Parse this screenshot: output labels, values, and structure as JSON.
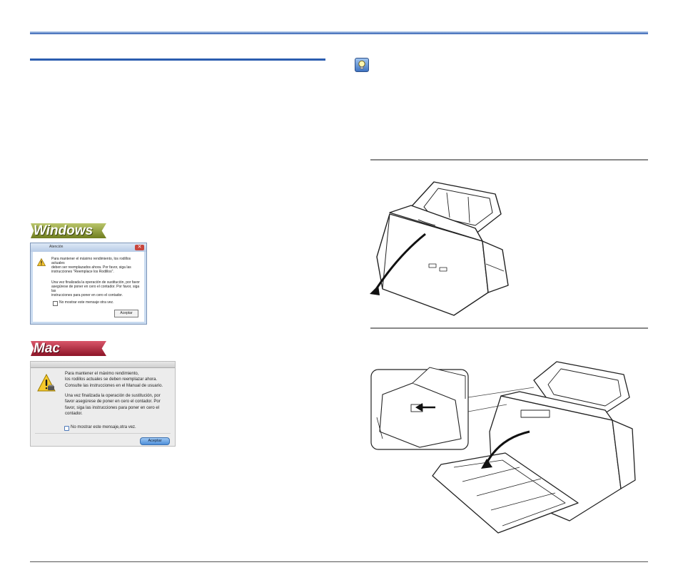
{
  "windows_badge": "Windows",
  "mac_badge": "Mac",
  "windows_dialog": {
    "title": "Atención",
    "close_glyph": "✕",
    "message_line1": "Para mantener el máximo rendimiento, los rodillos actuales",
    "message_line2": "deben ser reemplazados ahora. Por favor, siga las",
    "message_line3": "instrucciones \"Reemplace los Rodillos\".",
    "detail_line1": "Una vez finalizada la operación de sustitución, por favor",
    "detail_line2": "asegúrese de poner en cero el contador. Por favor, siga las",
    "detail_line3": "instrucciones para poner en cero el contador.",
    "checkbox_label": "No mostrar este mensaje otra vez.",
    "ok_label": "Aceptar"
  },
  "mac_dialog": {
    "message_line1": "Para mantener el máximo rendimiento,",
    "message_line2": "los rodillos actuales se deben reemplazar ahora.",
    "message_line3": "Consulte las instrucciones en el Manual de usuario.",
    "detail_line1": "Una vez finalizada la operación de sustitución, por",
    "detail_line2": "favor asegúrese de poner en cero el contador. Por",
    "detail_line3": "favor, siga las instrucciones para poner en cero el",
    "detail_line4": "contador.",
    "checkbox_label": "No mostrar este mensaje,otra vez.",
    "ok_label": "Aceptar"
  },
  "colors": {
    "accent_blue": "#2c5db0",
    "windows_badge": "#7d8b2a",
    "mac_badge": "#a01b30"
  },
  "icons": {
    "tip": "lightbulb-icon",
    "warning": "warning-triangle-icon"
  }
}
